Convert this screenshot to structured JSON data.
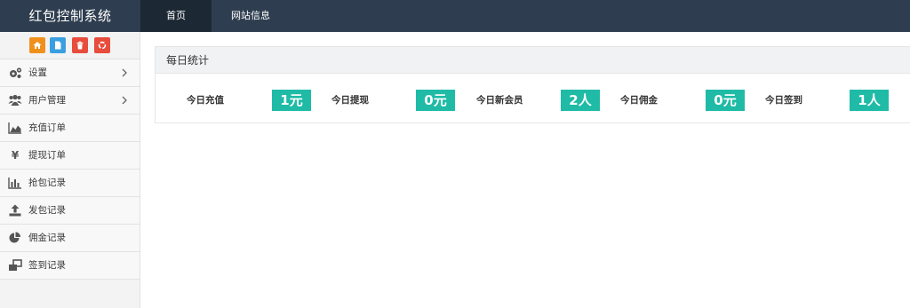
{
  "app": {
    "title": "红包控制系统"
  },
  "nav": {
    "tabs": [
      {
        "label": "首页",
        "active": true
      },
      {
        "label": "网站信息",
        "active": false
      }
    ]
  },
  "shortcuts": [
    {
      "icon": "home-icon",
      "color": "#f0901c"
    },
    {
      "icon": "document-icon",
      "color": "#3a9fe0"
    },
    {
      "icon": "trash-icon",
      "color": "#e74c3c"
    },
    {
      "icon": "recycle-icon",
      "color": "#e74c3c"
    }
  ],
  "sidebar": {
    "items": [
      {
        "label": "设置",
        "icon": "gears-icon",
        "has_submenu": true
      },
      {
        "label": "用户管理",
        "icon": "users-icon",
        "has_submenu": true
      },
      {
        "label": "充值订单",
        "icon": "area-chart-icon",
        "has_submenu": false
      },
      {
        "label": "提现订单",
        "icon": "yen-icon",
        "glyph": "¥",
        "has_submenu": false
      },
      {
        "label": "抢包记录",
        "icon": "bar-chart-icon",
        "has_submenu": false
      },
      {
        "label": "发包记录",
        "icon": "upload-icon",
        "has_submenu": false
      },
      {
        "label": "佣金记录",
        "icon": "pie-chart-icon",
        "has_submenu": false
      },
      {
        "label": "签到记录",
        "icon": "windows-icon",
        "has_submenu": false
      }
    ]
  },
  "daily": {
    "title": "每日统计",
    "stats": [
      {
        "label": "今日充值",
        "value": "1元"
      },
      {
        "label": "今日提现",
        "value": "0元"
      },
      {
        "label": "今日新会员",
        "value": "2人"
      },
      {
        "label": "今日佣金",
        "value": "0元"
      },
      {
        "label": "今日签到",
        "value": "1人"
      }
    ]
  },
  "colors": {
    "topbar": "#2e3d4f",
    "active_tab": "#1d2835",
    "stat_badge": "#1fbba6",
    "sidebar": "#f3f3f3"
  }
}
